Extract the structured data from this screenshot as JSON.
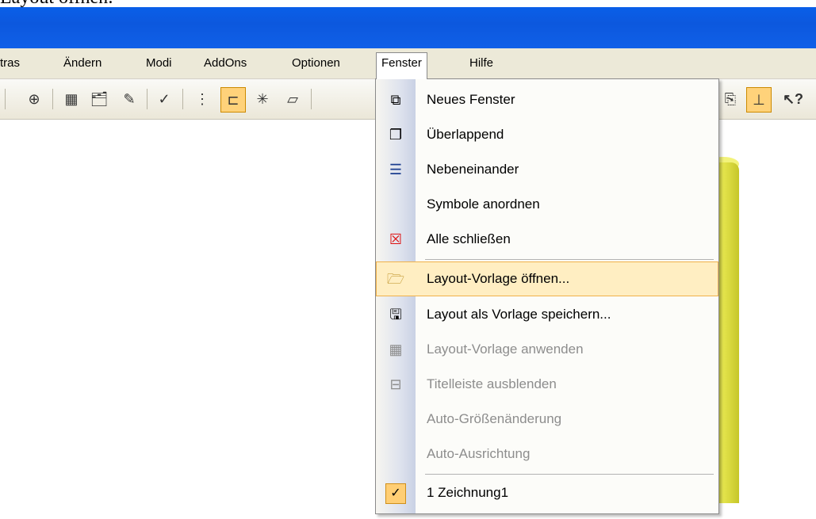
{
  "caption": "Layout öffnen:",
  "menubar": {
    "items": [
      {
        "label": "Extras",
        "visible_label": "tras"
      },
      {
        "label": "Ändern"
      },
      {
        "label": "Modi"
      },
      {
        "label": "AddOns"
      },
      {
        "label": "Optionen"
      },
      {
        "label": "Fenster"
      },
      {
        "label": "Hilfe"
      }
    ]
  },
  "toolbar": {
    "icons": [
      "separator",
      "zoom-icon",
      "separator",
      "layer-icon",
      "folder-icon",
      "pencil-icon",
      "separator",
      "spellcheck-icon",
      "separator",
      "grid-icon",
      "ortho-icon",
      "snap-icon",
      "plane-icon",
      "separator",
      "copy-icon",
      "axis-icon",
      "help-pointer-icon"
    ]
  },
  "fenster_menu": {
    "items": [
      {
        "label": "Neues Fenster",
        "icon": "new-window-icon",
        "enabled": true
      },
      {
        "label": "Überlappend",
        "icon": "cascade-icon",
        "enabled": true
      },
      {
        "label": "Nebeneinander",
        "icon": "tile-icon",
        "enabled": true
      },
      {
        "label": "Symbole anordnen",
        "icon": "",
        "enabled": true
      },
      {
        "label": "Alle schließen",
        "icon": "close-all-icon",
        "enabled": true
      },
      {
        "label": "Layout-Vorlage öffnen...",
        "icon": "open-layout-icon",
        "enabled": true,
        "highlighted": true
      },
      {
        "label": "Layout als Vorlage speichern...",
        "icon": "save-layout-icon",
        "enabled": true
      },
      {
        "label": "Layout-Vorlage anwenden",
        "icon": "apply-layout-icon",
        "enabled": false
      },
      {
        "label": "Titelleiste ausblenden",
        "icon": "hide-titlebar-icon",
        "enabled": false
      },
      {
        "label": "Auto-Größenänderung",
        "icon": "",
        "enabled": false
      },
      {
        "label": "Auto-Ausrichtung",
        "icon": "",
        "enabled": false
      },
      {
        "label": "1 Zeichnung1",
        "icon": "check-icon",
        "enabled": true,
        "checked": true
      }
    ]
  },
  "colors": {
    "titlebar": "#0c58de",
    "highlight": "#ffeec2",
    "highlight_border": "#f0b14a",
    "cylinder": "#d6d640"
  }
}
